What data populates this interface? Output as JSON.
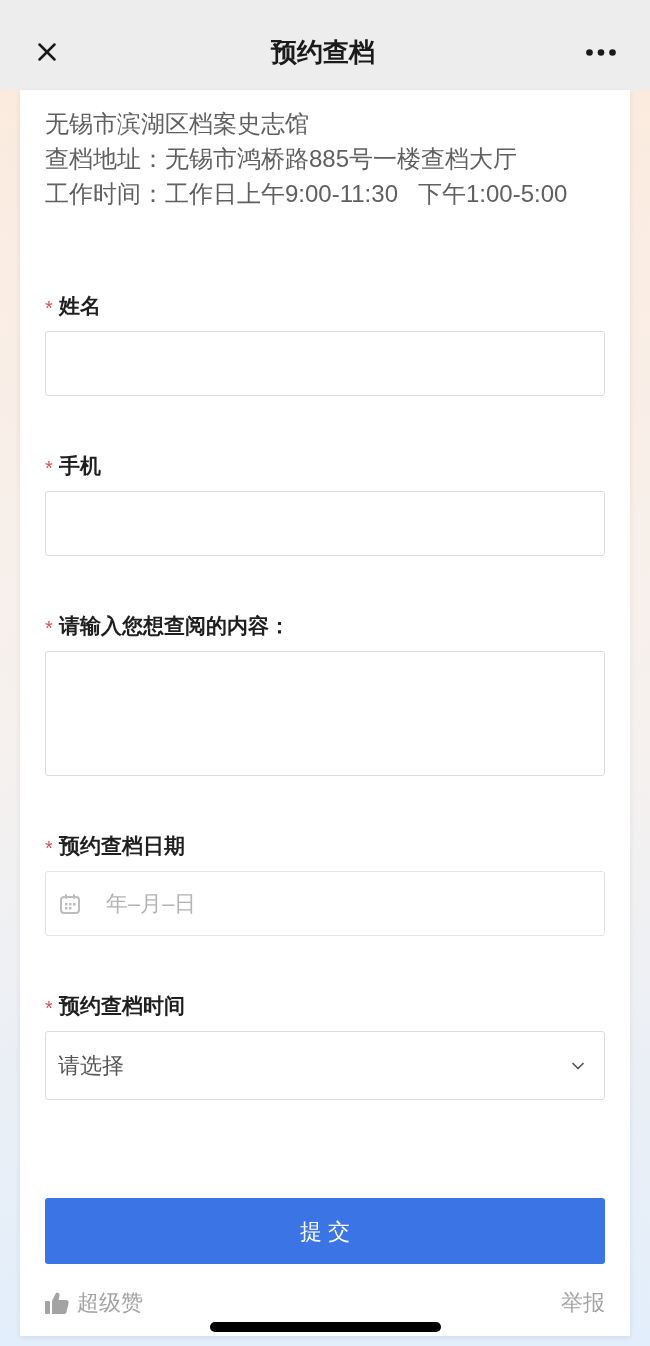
{
  "nav": {
    "title": "预约查档"
  },
  "info": [
    "无锡市滨湖区档案史志馆",
    "查档地址：无锡市鸿桥路885号一楼查档大厅",
    "工作时间：工作日上午9:00-11:30   下午1:00-5:00"
  ],
  "fields": [
    {
      "kind": "text",
      "required_mark": "*",
      "label": "姓名"
    },
    {
      "kind": "text",
      "required_mark": "*",
      "label": "手机"
    },
    {
      "kind": "textarea",
      "required_mark": "*",
      "label": "请输入您想查阅的内容："
    },
    {
      "kind": "date",
      "required_mark": "*",
      "label": "预约查档日期",
      "placeholder": "年–月–日"
    },
    {
      "kind": "select",
      "required_mark": "*",
      "label": "预约查档时间",
      "placeholder": "请选择"
    }
  ],
  "submit": {
    "label": "提 交"
  },
  "footer": {
    "like": "超级赞",
    "report": "举报"
  }
}
